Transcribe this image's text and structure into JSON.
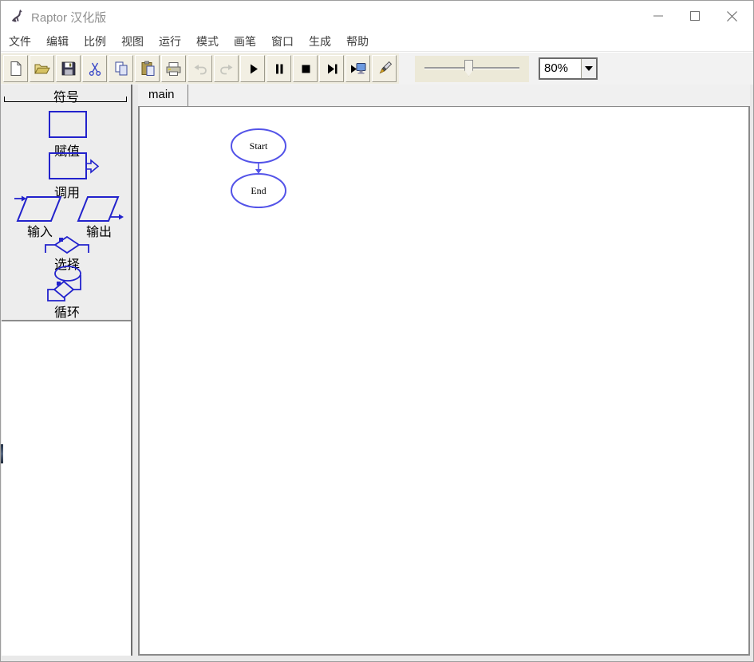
{
  "window": {
    "title": "Raptor 汉化版",
    "controls": [
      "minimize",
      "maximize",
      "close"
    ]
  },
  "menu": {
    "items": [
      "文件",
      "编辑",
      "比例",
      "视图",
      "运行",
      "模式",
      "画笔",
      "窗口",
      "生成",
      "帮助"
    ]
  },
  "toolbar": {
    "buttons": [
      {
        "name": "new",
        "icon": "new-document-icon",
        "enabled": true
      },
      {
        "name": "open",
        "icon": "open-folder-icon",
        "enabled": true
      },
      {
        "name": "save",
        "icon": "save-floppy-icon",
        "enabled": true
      },
      {
        "name": "cut",
        "icon": "scissors-icon",
        "enabled": true
      },
      {
        "name": "copy",
        "icon": "copy-pages-icon",
        "enabled": true
      },
      {
        "name": "paste",
        "icon": "clipboard-paste-icon",
        "enabled": true
      },
      {
        "name": "print",
        "icon": "printer-icon",
        "enabled": true
      },
      {
        "name": "undo",
        "icon": "undo-arrow-icon",
        "enabled": false
      },
      {
        "name": "redo",
        "icon": "redo-arrow-icon",
        "enabled": false
      },
      {
        "name": "play",
        "icon": "play-icon",
        "enabled": true
      },
      {
        "name": "pause",
        "icon": "pause-icon",
        "enabled": true
      },
      {
        "name": "stop",
        "icon": "stop-icon",
        "enabled": true
      },
      {
        "name": "step",
        "icon": "step-forward-icon",
        "enabled": true
      },
      {
        "name": "run-console",
        "icon": "monitor-play-icon",
        "enabled": true
      },
      {
        "name": "pen",
        "icon": "pen-icon",
        "enabled": true
      }
    ],
    "speed_slider": {
      "position_percent": 45
    },
    "zoom": {
      "value": "80%"
    }
  },
  "symbols_panel": {
    "header": "符号",
    "items": [
      {
        "name": "assignment",
        "label": "赋值"
      },
      {
        "name": "call",
        "label": "调用"
      },
      {
        "name": "input",
        "label": "输入"
      },
      {
        "name": "output",
        "label": "输出"
      },
      {
        "name": "selection",
        "label": "选择"
      },
      {
        "name": "loop",
        "label": "循环"
      }
    ]
  },
  "tabs": {
    "active": "main"
  },
  "flowchart": {
    "nodes": [
      {
        "label": "Start"
      },
      {
        "label": "End"
      }
    ],
    "edge": "start-to-end"
  },
  "colors": {
    "symbol_blue": "#2222cc",
    "flow_blue": "#5353e8",
    "toolbar_beige": "#ece9d8"
  }
}
